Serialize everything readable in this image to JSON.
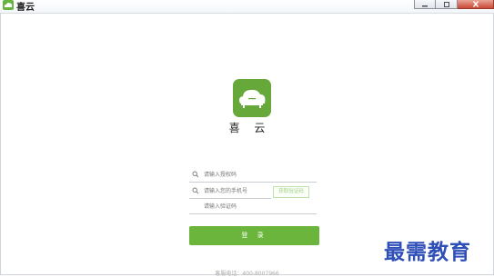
{
  "window": {
    "title": "喜云",
    "icon": "app-cloud-icon",
    "controls": [
      "minimize-icon",
      "maximize-icon",
      "close-icon"
    ]
  },
  "brand": {
    "name": "喜 云",
    "logo_icon": "cloud-sofa-icon",
    "accent": "#67a83a"
  },
  "form": {
    "auth_code_placeholder": "请输入授权码",
    "phone_placeholder": "请输入您的手机号",
    "verify_code_placeholder": "请输入验证码",
    "get_code_label": "获取验证码",
    "login_label": "登 录",
    "button_color": "#6bb53c"
  },
  "footer": {
    "hotline": "客服电话：400-8007966"
  },
  "watermark": {
    "text": "最需教育"
  }
}
